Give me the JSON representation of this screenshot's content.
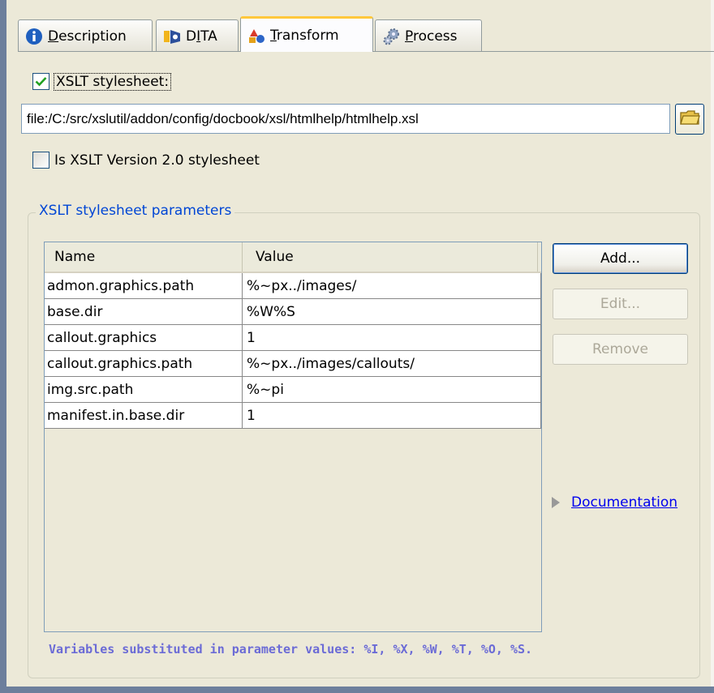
{
  "tabs": [
    {
      "label": "Description",
      "mnemonic": "D",
      "icon": "info-icon"
    },
    {
      "label": "DITA",
      "mnemonic": "I",
      "icon": "dita-icon"
    },
    {
      "label": "Transform",
      "mnemonic": "T",
      "icon": "transform-icon",
      "active": true
    },
    {
      "label": "Process",
      "mnemonic": "P",
      "icon": "gears-icon"
    }
  ],
  "xslt": {
    "checkbox_label": "XSLT stylesheet:",
    "checked": true,
    "path": "file:/C:/src/xslutil/addon/config/docbook/xsl/htmlhelp/htmlhelp.xsl",
    "browse_icon": "folder-icon"
  },
  "version2": {
    "label": "Is XSLT Version 2.0 stylesheet",
    "checked": false
  },
  "params": {
    "group_title": "XSLT stylesheet parameters",
    "columns": [
      "Name",
      "Value"
    ],
    "rows": [
      {
        "name": "admon.graphics.path",
        "value": "%~px../images/"
      },
      {
        "name": "base.dir",
        "value": "%W%S"
      },
      {
        "name": "callout.graphics",
        "value": "1"
      },
      {
        "name": "callout.graphics.path",
        "value": "%~px../images/callouts/"
      },
      {
        "name": "img.src.path",
        "value": "%~pi"
      },
      {
        "name": "manifest.in.base.dir",
        "value": "1"
      }
    ],
    "buttons": {
      "add": "Add...",
      "edit": "Edit...",
      "remove": "Remove"
    },
    "documentation_link": "Documentation",
    "note": "Variables substituted in parameter values: %I, %X, %W, %T, %O, %S."
  },
  "colors": {
    "group_title": "#0046d5",
    "note": "#6b6bd6",
    "active_tab_accent": "#ffc83c"
  }
}
